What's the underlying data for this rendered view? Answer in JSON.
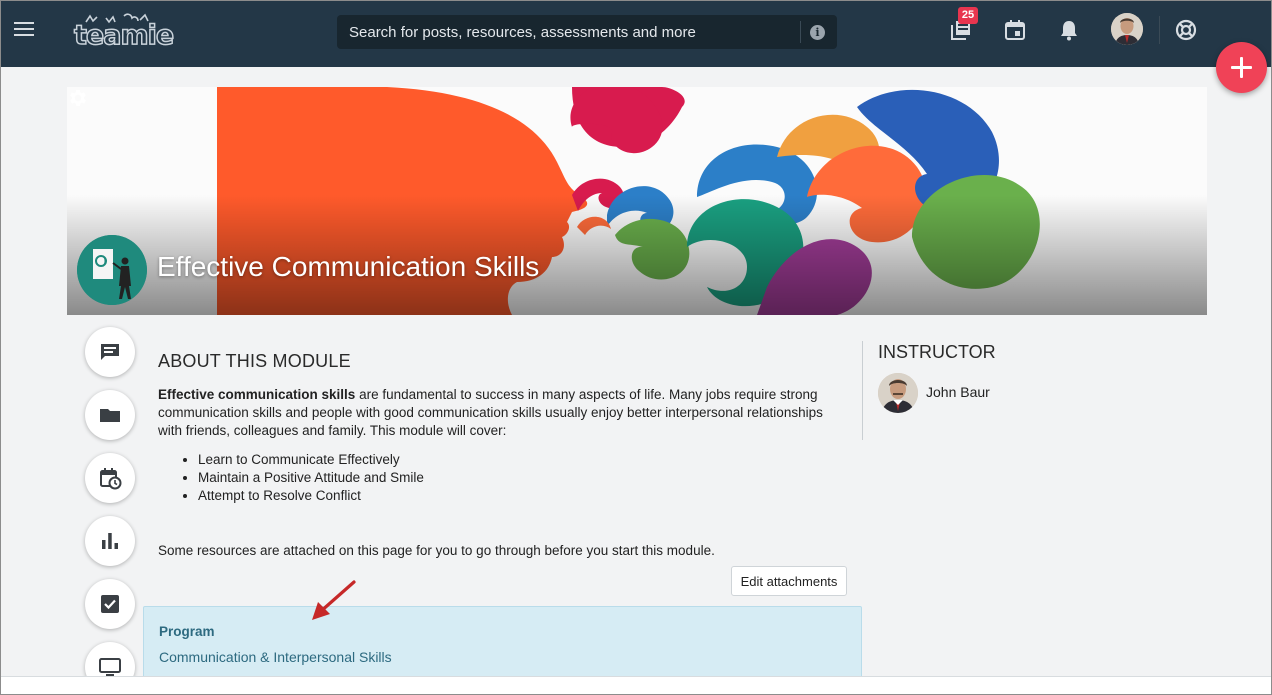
{
  "header": {
    "logo_text": "teamie",
    "search_placeholder": "Search for posts, resources, assessments and more",
    "notification_count": "25"
  },
  "icons": {
    "menu": "hamburger-icon",
    "search_info": "info-icon",
    "activity": "stack-icon",
    "calendar": "calendar-icon",
    "notifications": "bell-icon",
    "help": "lifebuoy-icon",
    "add": "plus-icon",
    "settings": "gear-icon",
    "side_nav": [
      "message-icon",
      "folder-icon",
      "calendar-clock-icon",
      "bar-chart-icon",
      "checkbox-icon",
      "monitor-icon"
    ]
  },
  "colors": {
    "topbar": "#233747",
    "accent": "#f04257",
    "card_bg": "#d6ecf4",
    "link": "#2d6a80"
  },
  "course": {
    "title": "Effective Communication Skills"
  },
  "about": {
    "heading": "ABOUT THIS MODULE",
    "intro_bold": "Effective communication skills",
    "intro_rest": " are fundamental to success in many aspects of life. Many jobs require strong communication skills and people with good communication skills usually enjoy better interpersonal relationships with friends, colleagues and family. This module will cover:",
    "topics": [
      "Learn to Communicate Effectively",
      "Maintain a Positive Attitude and Smile",
      "Attempt to Resolve Conflict"
    ],
    "resources_note": "Some resources are attached on this page for you to go through before you start this module."
  },
  "attachments": {
    "edit_label": "Edit attachments",
    "items": [
      {
        "type": "Program",
        "title": "Communication & Interpersonal Skills"
      }
    ]
  },
  "instructor": {
    "heading": "INSTRUCTOR",
    "name": "John Baur"
  }
}
